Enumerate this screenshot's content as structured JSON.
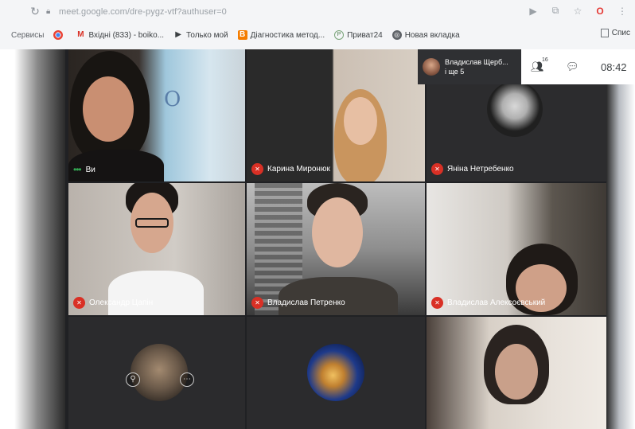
{
  "browser": {
    "url": "meet.google.com/dre-pygz-vtf?authuser=0",
    "bookmarks": [
      {
        "label": "Сервисы",
        "icon": "apps-icon"
      },
      {
        "label": "",
        "icon": "chrome-icon"
      },
      {
        "label": "Вхідні (833) - boiko...",
        "icon": "gmail-icon"
      },
      {
        "label": "Только мой",
        "icon": "play-icon"
      },
      {
        "label": "Діагностика метод...",
        "icon": "blogger-icon"
      },
      {
        "label": "Приват24",
        "icon": "privat-icon"
      },
      {
        "label": "Новая вкладка",
        "icon": "globe-icon"
      }
    ],
    "bookmark_right": "Спис"
  },
  "meet": {
    "presenter": {
      "name": "Владислав Щерб...",
      "more": "і ще 5"
    },
    "controls": {
      "participants_count": "16",
      "time": "08:42"
    },
    "tiles": [
      {
        "name": "Ви",
        "muted": false
      },
      {
        "name": "Карина Миронюк",
        "muted": true
      },
      {
        "name": "Яніна Нетребенко",
        "muted": true
      },
      {
        "name": "Олександр Цапін",
        "muted": true
      },
      {
        "name": "Владислав Петренко",
        "muted": true
      },
      {
        "name": "Владислав Алексоєвський",
        "muted": true
      },
      {
        "name": "",
        "muted": false
      },
      {
        "name": "",
        "muted": false
      },
      {
        "name": "",
        "muted": false
      }
    ]
  },
  "colors": {
    "mic_muted": "#d93025",
    "meet_bg": "#202124"
  }
}
